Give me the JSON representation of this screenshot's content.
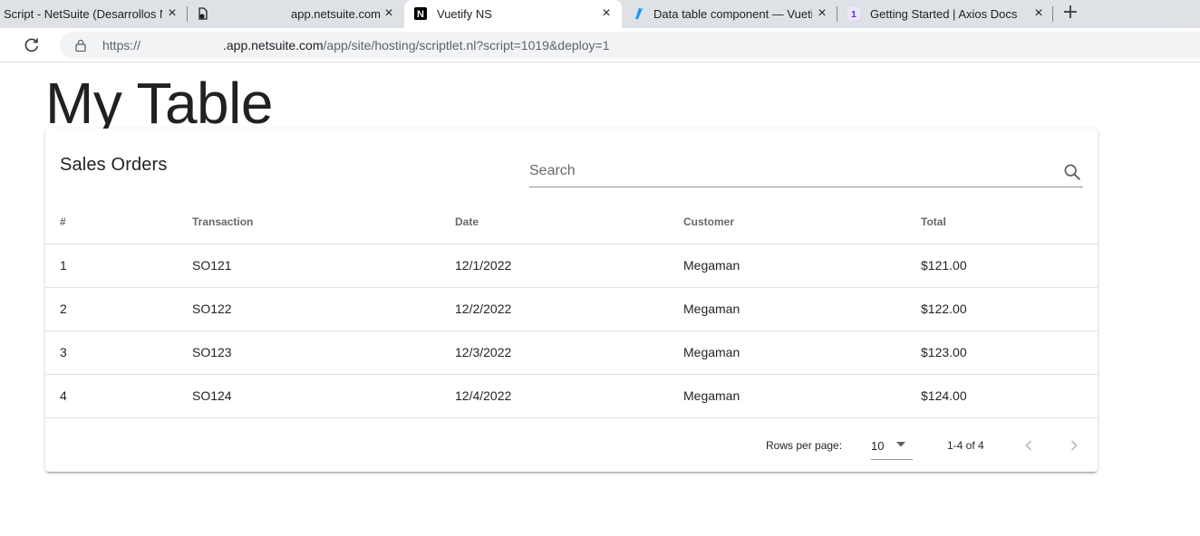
{
  "browser": {
    "tabs": [
      {
        "title": "Script - NetSuite (Desarrollos Ne",
        "close": "×"
      },
      {
        "title": "app.netsuite.com",
        "close": "×"
      },
      {
        "title": "Vuetify NS",
        "close": "×",
        "active": true
      },
      {
        "title": "Data table component — Vuetify",
        "close": "×"
      },
      {
        "title": "Getting Started | Axios Docs",
        "close": "×"
      }
    ],
    "new_tab": "+",
    "address": {
      "scheme": "https://",
      "host": ".app.netsuite.com",
      "path": "/app/site/hosting/scriptlet.nl?script=1019&deploy=1"
    }
  },
  "page": {
    "title": "My Table"
  },
  "card": {
    "title": "Sales Orders",
    "search_placeholder": "Search",
    "search_value": ""
  },
  "table": {
    "headers": [
      "#",
      "Transaction",
      "Date",
      "Customer",
      "Total"
    ],
    "rows": [
      [
        "1",
        "SO121",
        "12/1/2022",
        "Megaman",
        "$121.00"
      ],
      [
        "2",
        "SO122",
        "12/2/2022",
        "Megaman",
        "$122.00"
      ],
      [
        "3",
        "SO123",
        "12/3/2022",
        "Megaman",
        "$123.00"
      ],
      [
        "4",
        "SO124",
        "12/4/2022",
        "Megaman",
        "$124.00"
      ]
    ]
  },
  "footer": {
    "rows_per_page_label": "Rows per page:",
    "rows_per_page_value": "10",
    "page_range": "1-4 of 4"
  },
  "icons": {
    "reload": "reload-icon",
    "lock": "lock-icon",
    "search": "search-icon",
    "caret": "caret-down-icon",
    "prev": "chevron-left-icon",
    "next": "chevron-right-icon"
  },
  "colors": {
    "tabstrip_bg": "#dee1e6",
    "omnibox_bg": "#f1f3f4",
    "vuetify_brand": "#1697f6",
    "axios_brand": "#5a29e4"
  }
}
